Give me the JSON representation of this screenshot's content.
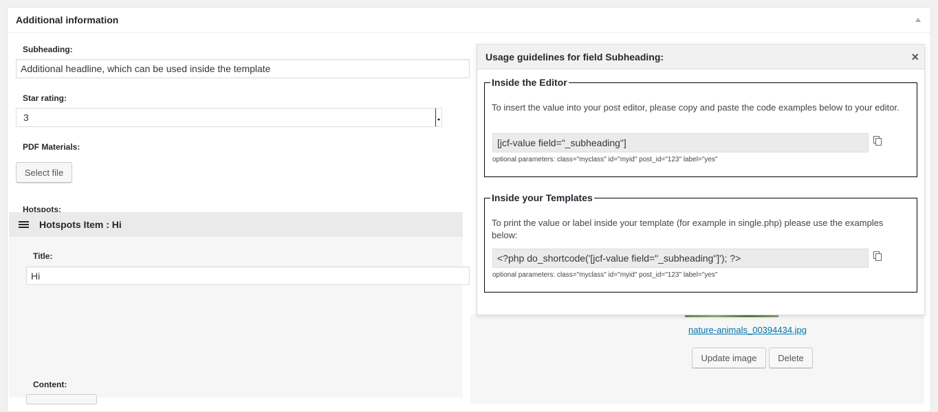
{
  "postbox": {
    "title": "Additional information"
  },
  "fields": {
    "subheading": {
      "label": "Subheading:",
      "value": "Additional headline, which can be used inside the template"
    },
    "star_rating": {
      "label": "Star rating:",
      "value": "3"
    },
    "pdf": {
      "label": "PDF Materials:",
      "button": "Select file"
    },
    "hotspots": {
      "label": "Hotspots:",
      "item_title": "Hotspots Item : Hi",
      "title_label": "Title:",
      "title_value": "Hi",
      "content_label": "Content:"
    }
  },
  "image": {
    "filename": "nature-animals_00394434.jpg",
    "update_button": "Update image",
    "delete_button": "Delete"
  },
  "modal": {
    "title": "Usage guidelines for field Subheading:",
    "editor": {
      "legend": "Inside the Editor",
      "description": "To insert the value into your post editor, please copy and paste the code examples below to your editor.",
      "code": "[jcf-value field=\"_subheading\"]",
      "optional": "optional parameters: class=\"myclass\" id=\"myid\" post_id=\"123\" label=\"yes\""
    },
    "templates": {
      "legend": "Inside your Templates",
      "description": "To print the value or label inside your template (for example in single.php) please use the examples below:",
      "code": "<?php do_shortcode('[jcf-value field=\"_subheading\"]'); ?>",
      "optional": "optional parameters: class=\"myclass\" id=\"myid\" post_id=\"123\" label=\"yes\""
    }
  },
  "icons": [
    "toggle-arrow-icon",
    "hamburger-icon",
    "close-icon",
    "copy-icon"
  ]
}
